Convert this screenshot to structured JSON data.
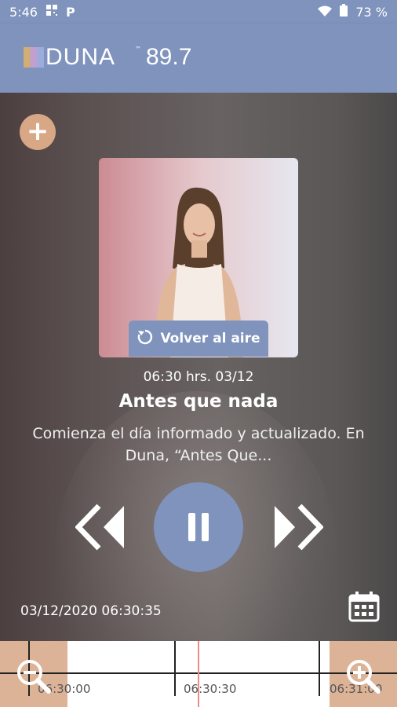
{
  "status": {
    "time": "5:46",
    "app_badge": "P",
    "battery": "73 %"
  },
  "brand": {
    "name": "DUNA",
    "tm": "™",
    "frequency": "89.7"
  },
  "player": {
    "back_to_live": "Volver al aire",
    "schedule": "06:30 hrs. 03/12",
    "show_title": "Antes que nada",
    "description": "Comienza el día informado y actualizado. En Duna, “Antes Que...",
    "current_datetime": "03/12/2020 06:30:35"
  },
  "timeline": {
    "labels": [
      "06:30:00",
      "06:30:30",
      "06:31:00"
    ]
  },
  "icons": {
    "add": "plus-icon",
    "refresh": "refresh-icon",
    "prev": "double-chevron-left-icon",
    "pause": "pause-icon",
    "next": "double-chevron-right-icon",
    "calendar": "calendar-icon",
    "zoom_out": "zoom-out-icon",
    "zoom_in": "zoom-in-icon"
  },
  "colors": {
    "accent": "#7f93bd",
    "secondary": "#d7a786"
  }
}
